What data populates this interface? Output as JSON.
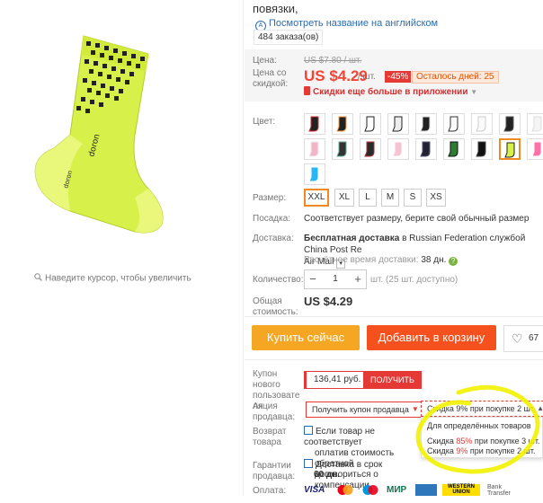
{
  "product": {
    "title_tail": "повязки,",
    "translate_link": "Посмотреть название на английском",
    "orders": "484 заказа(ов)"
  },
  "zoom_hint": "Наведите курсор, чтобы увеличить",
  "price": {
    "label_price": "Цена:",
    "old_price": "US $7.80 / шт.",
    "label_discount_1": "Цена со",
    "label_discount_2": "скидкой:",
    "current_price": "US $4.29",
    "per_unit": "/ шт.",
    "discount_pct": "-45%",
    "days_left": "Осталось дней: 25",
    "app_deal": "Скидки еще больше в приложении"
  },
  "colors": {
    "label": "Цвет:",
    "row_1": [
      "jersey-black-1",
      "jersey-black-2",
      "bib-white",
      "jersey-white",
      "jersey-black-3",
      "bib-white-2",
      "sleeve-white",
      "sleeve-black",
      "socks-white"
    ],
    "row_2": [
      "socks-pink",
      "socks-multi",
      "socks-dark",
      "socks-pink-2",
      "socks-navy",
      "socks-green",
      "socks-black",
      "socks-yellow",
      "socks-pink-3"
    ],
    "row_3": [
      "socks-blue"
    ],
    "selected": "socks-yellow"
  },
  "sizes": {
    "label": "Размер:",
    "options": [
      "XXL",
      "XL",
      "L",
      "M",
      "S",
      "XS"
    ],
    "selected": "XXL"
  },
  "fit": {
    "label": "Посадка:",
    "text": "Соответствует размеру, берите свой обычный размер"
  },
  "shipping": {
    "label": "Доставка:",
    "bold": "Бесплатная доставка",
    "rest_1": " в Russian Federation службой China Post Re",
    "rest_2": "Air Mail",
    "eta_label": "Расчётное время доставки:",
    "eta_value": "38 дн."
  },
  "quantity": {
    "label": "Количество:",
    "minus": "−",
    "value": "1",
    "plus": "+",
    "note": "шт. (25 шт. доступно)"
  },
  "total": {
    "label_1": "Общая",
    "label_2": "стоимость:",
    "value": "US $4.29"
  },
  "actions": {
    "buy_now": "Купить сейчас",
    "add_to_cart": "Добавить в корзину",
    "wishlist_count": "67"
  },
  "coupons": {
    "new_user_label_1": "Купон нового",
    "new_user_label_2": "пользовате",
    "new_user_label_3": "ля",
    "coupon_value": "136,41 руб.",
    "get_button": "ПОЛУЧИТЬ",
    "promo_label_1": "Акция",
    "promo_label_2": "продавца:",
    "seller_coupon": "Получить купон продавца",
    "discount_dropdown": "Скидка 9% при покупке 2 шт.",
    "dropdown_line_1": "Для определённых товаров",
    "dropdown_line_2_pre": "Скидка ",
    "dropdown_line_2_pct": "85%",
    "dropdown_line_2_post": " при покупке 3 шт.",
    "dropdown_line_3_pre": "Скидка ",
    "dropdown_line_3_pct": "9%",
    "dropdown_line_3_post": " при покупке 2 шт."
  },
  "returns": {
    "label_1": "Возврат",
    "label_2": "товара",
    "line_1": "Если товар не соответствует",
    "line_2": "оплатив стоимость обратной",
    "line_3": "договориться о компенсации"
  },
  "guarantee": {
    "label_1": "Гарантии",
    "label_2": "продавца:",
    "line_1": "Доставка в срок",
    "line_2": "60 дн."
  },
  "payment": {
    "label": "Оплата:",
    "methods": [
      "VISA",
      "MasterCard",
      "Maestro",
      "МИР",
      "AmEx",
      "WESTERN UNION",
      "Bank Transfer"
    ]
  },
  "colors_theme": {
    "accent_red": "#f44336",
    "buy_orange": "#f5a623",
    "cart_orange": "#f4511e",
    "selection": "#f08a24"
  }
}
